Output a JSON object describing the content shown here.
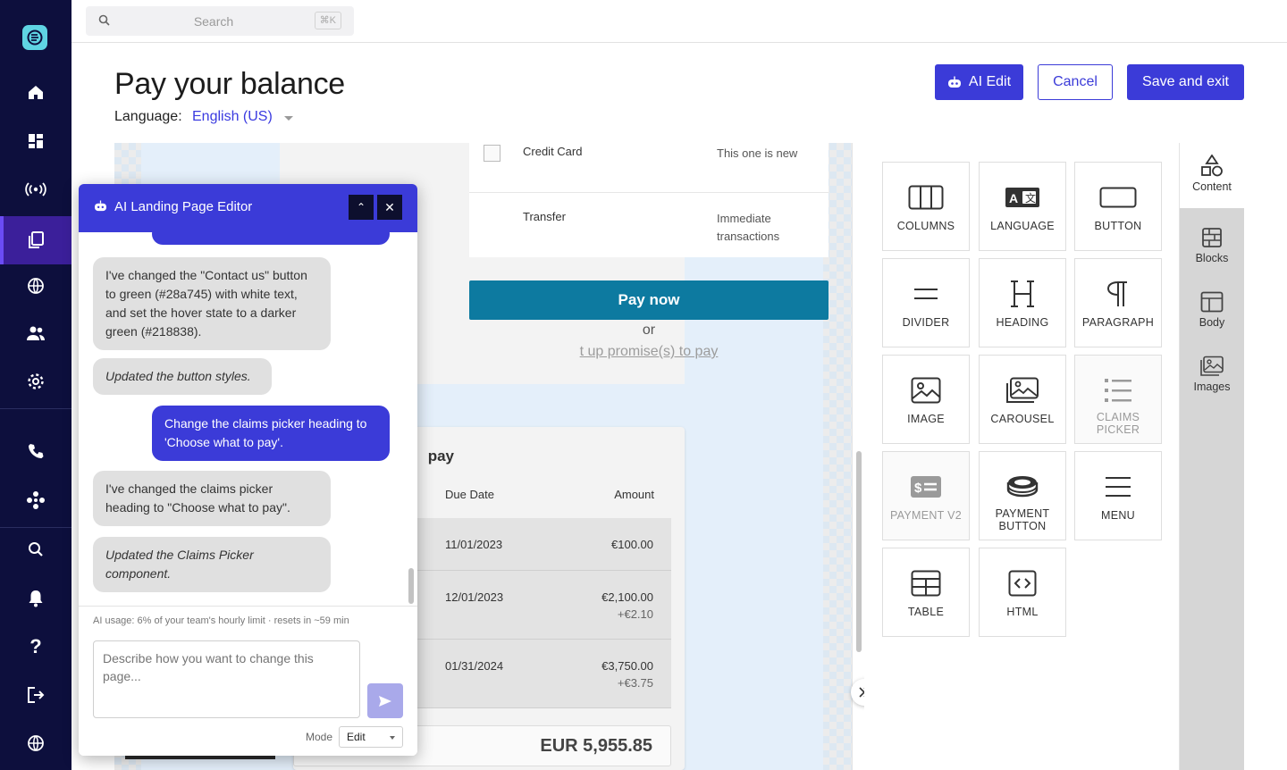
{
  "nav": {
    "items": [
      {
        "name": "home-icon"
      },
      {
        "name": "dashboard-icon"
      },
      {
        "name": "broadcast-icon"
      },
      {
        "name": "pages-icon"
      },
      {
        "name": "globe-icon"
      },
      {
        "name": "users-icon"
      },
      {
        "name": "settings-icon"
      },
      {
        "name": "phone-icon"
      },
      {
        "name": "integrations-icon"
      },
      {
        "name": "search-icon"
      },
      {
        "name": "bell-icon"
      },
      {
        "name": "help-icon"
      },
      {
        "name": "logout-icon"
      },
      {
        "name": "language-icon"
      }
    ]
  },
  "topbar": {
    "search_placeholder": "Search",
    "shortcut": "⌘K"
  },
  "page": {
    "title": "Pay your balance",
    "language_label": "Language:",
    "language_value": "English (US)"
  },
  "actions": {
    "ai_edit": "AI Edit",
    "cancel": "Cancel",
    "save": "Save and exit"
  },
  "preview": {
    "payment_methods": [
      {
        "name": "Credit Card",
        "desc": "This one is new"
      },
      {
        "name": "Transfer",
        "desc": "Immediate transactions"
      }
    ],
    "pay_now": "Pay now",
    "or": "or",
    "promise_link": "t up promise(s) to pay",
    "claims_title": "pay",
    "col_due": "Due Date",
    "col_amount": "Amount",
    "claims": [
      {
        "date": "11/01/2023",
        "amount": "€100.00",
        "fee": ""
      },
      {
        "date": "12/01/2023",
        "amount": "€2,100.00",
        "fee": "+€2.10"
      },
      {
        "date": "01/31/2024",
        "amount": "€3,750.00",
        "fee": "+€3.75"
      }
    ],
    "total": "EUR 5,955.85"
  },
  "tools": [
    {
      "label": "COLUMNS",
      "icon": "columns-icon",
      "disabled": false
    },
    {
      "label": "LANGUAGE",
      "icon": "language-icon",
      "disabled": false
    },
    {
      "label": "BUTTON",
      "icon": "button-icon",
      "disabled": false
    },
    {
      "label": "DIVIDER",
      "icon": "divider-icon",
      "disabled": false
    },
    {
      "label": "HEADING",
      "icon": "heading-icon",
      "disabled": false
    },
    {
      "label": "PARAGRAPH",
      "icon": "paragraph-icon",
      "disabled": false
    },
    {
      "label": "IMAGE",
      "icon": "image-icon",
      "disabled": false
    },
    {
      "label": "CAROUSEL",
      "icon": "carousel-icon",
      "disabled": false
    },
    {
      "label": "CLAIMS PICKER",
      "icon": "list-icon",
      "disabled": true
    },
    {
      "label": "PAYMENT V2",
      "icon": "payment-icon",
      "disabled": true
    },
    {
      "label": "PAYMENT BUTTON",
      "icon": "coin-icon",
      "disabled": false
    },
    {
      "label": "MENU",
      "icon": "menu-icon",
      "disabled": false
    },
    {
      "label": "TABLE",
      "icon": "table-icon",
      "disabled": false
    },
    {
      "label": "HTML",
      "icon": "code-icon",
      "disabled": false
    }
  ],
  "tabs": [
    {
      "label": "Content",
      "icon": "shapes-icon",
      "active": true
    },
    {
      "label": "Blocks",
      "icon": "blocks-icon",
      "active": false
    },
    {
      "label": "Body",
      "icon": "body-layout-icon",
      "active": false
    },
    {
      "label": "Images",
      "icon": "images-icon",
      "active": false
    }
  ],
  "ai_panel": {
    "title": "AI Landing Page Editor",
    "messages": [
      {
        "role": "bot",
        "text": "I've changed the \"Contact us\" button to green (#28a745) with white text, and set the hover state to a darker green (#218838)."
      },
      {
        "role": "bot-status",
        "text": "Updated the button styles."
      },
      {
        "role": "user",
        "text": "Change the claims picker heading to 'Choose what to pay'."
      },
      {
        "role": "bot",
        "text": "I've changed the claims picker heading to \"Choose what to pay\"."
      },
      {
        "role": "bot-status",
        "text": "Updated the Claims Picker component."
      }
    ],
    "usage": "AI usage: 6% of your team's hourly limit · resets in ~59 min",
    "prompt_placeholder": "Describe how you want to change this page...",
    "mode_label": "Mode",
    "mode_value": "Edit"
  },
  "colors": {
    "accent": "#3b3bd8",
    "nav_bg": "#0d0f3d",
    "pay_button": "#0d7aa0"
  }
}
